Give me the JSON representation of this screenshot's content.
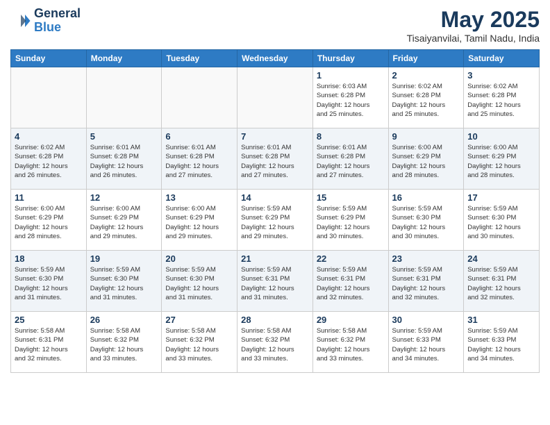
{
  "header": {
    "logo_line1": "General",
    "logo_line2": "Blue",
    "month": "May 2025",
    "location": "Tisaiyanvilai, Tamil Nadu, India"
  },
  "weekdays": [
    "Sunday",
    "Monday",
    "Tuesday",
    "Wednesday",
    "Thursday",
    "Friday",
    "Saturday"
  ],
  "weeks": [
    [
      {
        "day": "",
        "info": ""
      },
      {
        "day": "",
        "info": ""
      },
      {
        "day": "",
        "info": ""
      },
      {
        "day": "",
        "info": ""
      },
      {
        "day": "1",
        "info": "Sunrise: 6:03 AM\nSunset: 6:28 PM\nDaylight: 12 hours\nand 25 minutes."
      },
      {
        "day": "2",
        "info": "Sunrise: 6:02 AM\nSunset: 6:28 PM\nDaylight: 12 hours\nand 25 minutes."
      },
      {
        "day": "3",
        "info": "Sunrise: 6:02 AM\nSunset: 6:28 PM\nDaylight: 12 hours\nand 25 minutes."
      }
    ],
    [
      {
        "day": "4",
        "info": "Sunrise: 6:02 AM\nSunset: 6:28 PM\nDaylight: 12 hours\nand 26 minutes."
      },
      {
        "day": "5",
        "info": "Sunrise: 6:01 AM\nSunset: 6:28 PM\nDaylight: 12 hours\nand 26 minutes."
      },
      {
        "day": "6",
        "info": "Sunrise: 6:01 AM\nSunset: 6:28 PM\nDaylight: 12 hours\nand 27 minutes."
      },
      {
        "day": "7",
        "info": "Sunrise: 6:01 AM\nSunset: 6:28 PM\nDaylight: 12 hours\nand 27 minutes."
      },
      {
        "day": "8",
        "info": "Sunrise: 6:01 AM\nSunset: 6:28 PM\nDaylight: 12 hours\nand 27 minutes."
      },
      {
        "day": "9",
        "info": "Sunrise: 6:00 AM\nSunset: 6:29 PM\nDaylight: 12 hours\nand 28 minutes."
      },
      {
        "day": "10",
        "info": "Sunrise: 6:00 AM\nSunset: 6:29 PM\nDaylight: 12 hours\nand 28 minutes."
      }
    ],
    [
      {
        "day": "11",
        "info": "Sunrise: 6:00 AM\nSunset: 6:29 PM\nDaylight: 12 hours\nand 28 minutes."
      },
      {
        "day": "12",
        "info": "Sunrise: 6:00 AM\nSunset: 6:29 PM\nDaylight: 12 hours\nand 29 minutes."
      },
      {
        "day": "13",
        "info": "Sunrise: 6:00 AM\nSunset: 6:29 PM\nDaylight: 12 hours\nand 29 minutes."
      },
      {
        "day": "14",
        "info": "Sunrise: 5:59 AM\nSunset: 6:29 PM\nDaylight: 12 hours\nand 29 minutes."
      },
      {
        "day": "15",
        "info": "Sunrise: 5:59 AM\nSunset: 6:29 PM\nDaylight: 12 hours\nand 30 minutes."
      },
      {
        "day": "16",
        "info": "Sunrise: 5:59 AM\nSunset: 6:30 PM\nDaylight: 12 hours\nand 30 minutes."
      },
      {
        "day": "17",
        "info": "Sunrise: 5:59 AM\nSunset: 6:30 PM\nDaylight: 12 hours\nand 30 minutes."
      }
    ],
    [
      {
        "day": "18",
        "info": "Sunrise: 5:59 AM\nSunset: 6:30 PM\nDaylight: 12 hours\nand 31 minutes."
      },
      {
        "day": "19",
        "info": "Sunrise: 5:59 AM\nSunset: 6:30 PM\nDaylight: 12 hours\nand 31 minutes."
      },
      {
        "day": "20",
        "info": "Sunrise: 5:59 AM\nSunset: 6:30 PM\nDaylight: 12 hours\nand 31 minutes."
      },
      {
        "day": "21",
        "info": "Sunrise: 5:59 AM\nSunset: 6:31 PM\nDaylight: 12 hours\nand 31 minutes."
      },
      {
        "day": "22",
        "info": "Sunrise: 5:59 AM\nSunset: 6:31 PM\nDaylight: 12 hours\nand 32 minutes."
      },
      {
        "day": "23",
        "info": "Sunrise: 5:59 AM\nSunset: 6:31 PM\nDaylight: 12 hours\nand 32 minutes."
      },
      {
        "day": "24",
        "info": "Sunrise: 5:59 AM\nSunset: 6:31 PM\nDaylight: 12 hours\nand 32 minutes."
      }
    ],
    [
      {
        "day": "25",
        "info": "Sunrise: 5:58 AM\nSunset: 6:31 PM\nDaylight: 12 hours\nand 32 minutes."
      },
      {
        "day": "26",
        "info": "Sunrise: 5:58 AM\nSunset: 6:32 PM\nDaylight: 12 hours\nand 33 minutes."
      },
      {
        "day": "27",
        "info": "Sunrise: 5:58 AM\nSunset: 6:32 PM\nDaylight: 12 hours\nand 33 minutes."
      },
      {
        "day": "28",
        "info": "Sunrise: 5:58 AM\nSunset: 6:32 PM\nDaylight: 12 hours\nand 33 minutes."
      },
      {
        "day": "29",
        "info": "Sunrise: 5:58 AM\nSunset: 6:32 PM\nDaylight: 12 hours\nand 33 minutes."
      },
      {
        "day": "30",
        "info": "Sunrise: 5:59 AM\nSunset: 6:33 PM\nDaylight: 12 hours\nand 34 minutes."
      },
      {
        "day": "31",
        "info": "Sunrise: 5:59 AM\nSunset: 6:33 PM\nDaylight: 12 hours\nand 34 minutes."
      }
    ]
  ]
}
